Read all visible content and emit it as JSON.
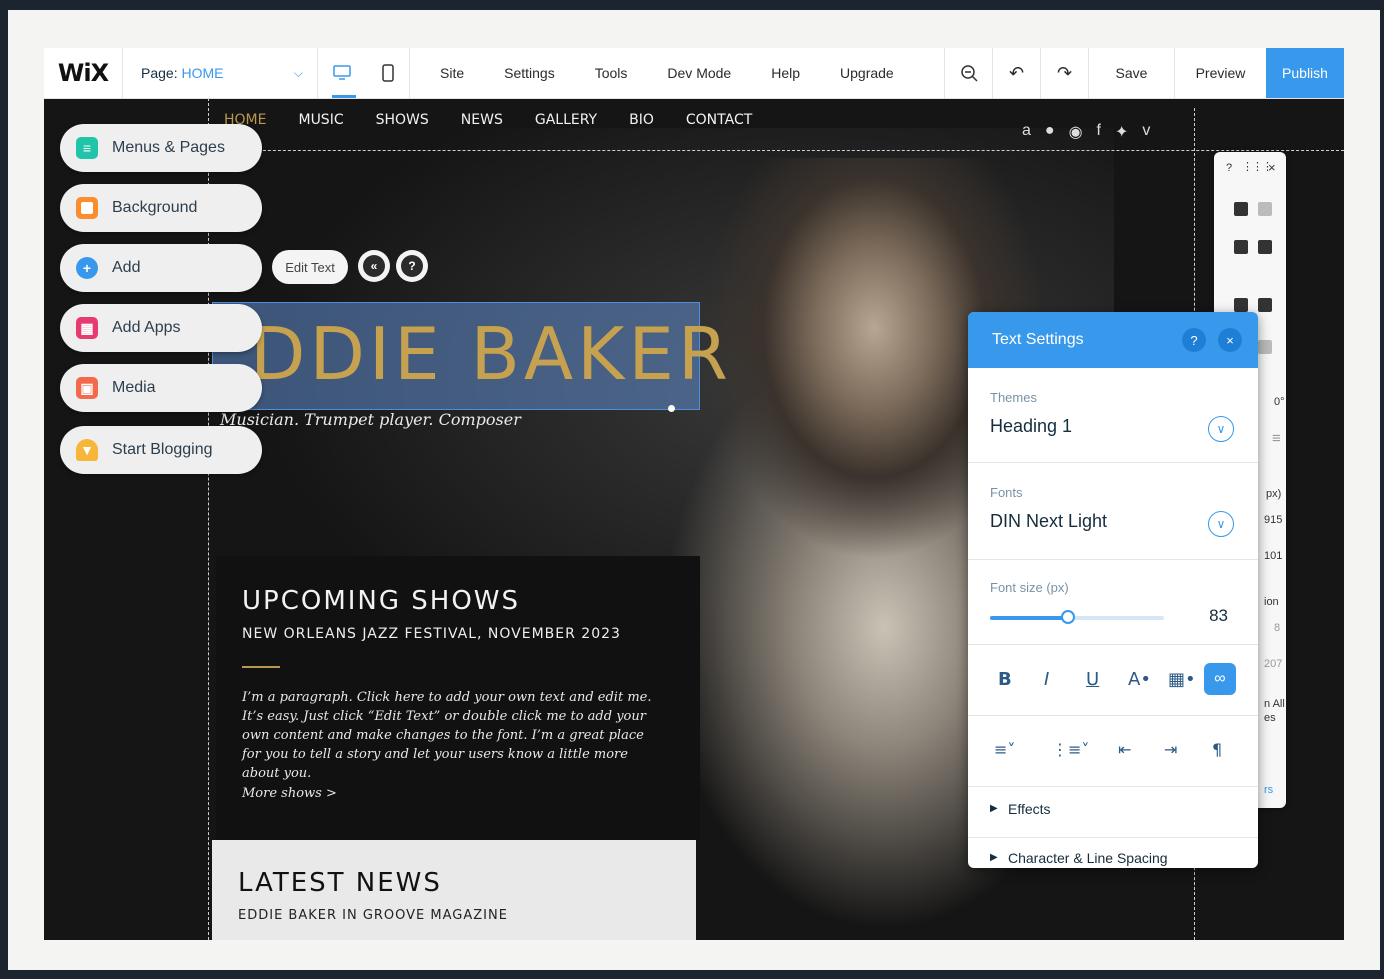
{
  "editor": {
    "logo": "WiX",
    "page_label": "Page:",
    "page_value": "HOME",
    "menu": [
      "Site",
      "Settings",
      "Tools",
      "Dev Mode",
      "Help",
      "Upgrade"
    ],
    "save": "Save",
    "preview": "Preview",
    "publish": "Publish",
    "accent": "#3899ec"
  },
  "site": {
    "nav": [
      "HOME",
      "MUSIC",
      "SHOWS",
      "NEWS",
      "GALLERY",
      "BIO",
      "CONTACT"
    ],
    "title": "DDIE BAKER",
    "subtitle": "Musician. Trumpet player. Composer",
    "edit_text": "Edit Text",
    "shows": {
      "heading": "UPCOMING SHOWS",
      "event": "NEW ORLEANS JAZZ FESTIVAL, NOVEMBER 2023",
      "paragraph": "I’m a paragraph. Click here to add your own text and edit me. It’s easy. Just click “Edit Text” or double click me to add your own content and make changes to the font. I’m a great place for you to tell a story and let your users know a little more about you.",
      "more": "More shows >"
    },
    "news": {
      "heading": "LATEST NEWS",
      "sub": "EDDIE BAKER IN GROOVE MAGAZINE"
    },
    "gold": "#c6a14f"
  },
  "left_panel": [
    "Menus & Pages",
    "Background",
    "Add",
    "Add Apps",
    "Media",
    "Start Blogging"
  ],
  "text_settings": {
    "title": "Text Settings",
    "themes_label": "Themes",
    "themes_value": "Heading 1",
    "fonts_label": "Fonts",
    "fonts_value": "DIN Next Light",
    "size_label": "Font size (px)",
    "size_value": "83",
    "size_fraction": 0.45,
    "effects": "Effects",
    "spacing": "Character & Line Spacing"
  },
  "right_toolbar": {
    "rotation": "0°",
    "peek": [
      "px)",
      "915",
      "101",
      "ion",
      "8",
      "207",
      "n All",
      "es",
      "rs"
    ]
  }
}
